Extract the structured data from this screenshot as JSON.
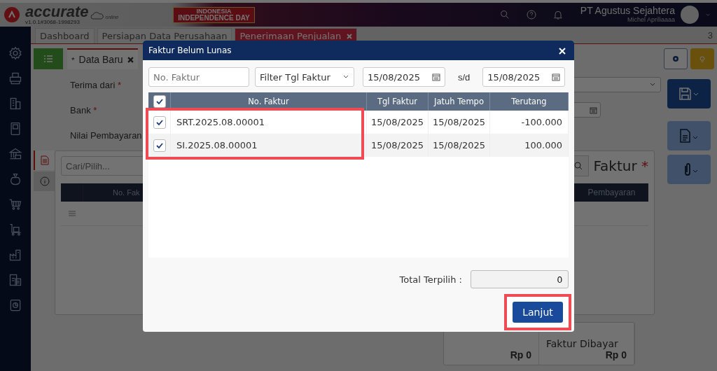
{
  "header": {
    "logo_text": "accurate",
    "logo_sub": "online",
    "version": "v1.0.1#3068-1998293",
    "banner_line1": "INDONESIA",
    "banner_line2": "INDEPENDENCE DAY",
    "company": "PT Agustus Sejahtera",
    "user": "Michel Apriliaaaa"
  },
  "tabs": [
    {
      "label": "Dashboard",
      "selected": false,
      "closable": false
    },
    {
      "label": "Persiapan Data Perusahaan",
      "selected": false,
      "closable": false
    },
    {
      "label": "Penerimaan Penjualan",
      "selected": true,
      "closable": true
    }
  ],
  "tab_count": "3",
  "document_tab": {
    "label": "$^{*}$Data Baru"
  },
  "form": {
    "fields": [
      {
        "label": "Terima dari",
        "mark": "*",
        "kind": "dropdown"
      },
      {
        "label": "Bank",
        "mark": "*",
        "kind": "date"
      },
      {
        "label": "Nilai Pembayaran",
        "kind": "text"
      }
    ]
  },
  "details": {
    "search_placeholder": "Cari/Pilih...",
    "title": "Faktur",
    "title_mark": "*",
    "columns": [
      "No. Fak",
      "Pembayaran"
    ]
  },
  "summary": [
    {
      "value": "Rp 0"
    },
    {
      "label": "Faktur Dibayar",
      "value": "Rp 0"
    }
  ],
  "dialog": {
    "title": "Faktur Belum Lunas",
    "search": {
      "placeholder": "No. Faktur"
    },
    "filter": "Filter Tgl Faktur",
    "date_from": "15/08/2025",
    "range_sep": "s/d",
    "date_to": "15/08/2025",
    "all_checked": true,
    "columns": [
      "No. Faktur",
      "Tgl Faktur",
      "Jatuh Tempo",
      "Terutang"
    ],
    "rows": [
      {
        "checked": true,
        "highlighted": true,
        "cells": [
          "SRT.2025.08.00001",
          "15/08/2025",
          "15/08/2025",
          "-100.000"
        ]
      },
      {
        "checked": true,
        "highlighted": true,
        "cells": [
          "SI.2025.08.00001",
          "15/08/2025",
          "15/08/2025",
          "100.000"
        ]
      }
    ],
    "total_label": "Total Terpilih :",
    "total_value": "0",
    "button": {
      "label": "Lanjut",
      "highlighted": true
    }
  }
}
